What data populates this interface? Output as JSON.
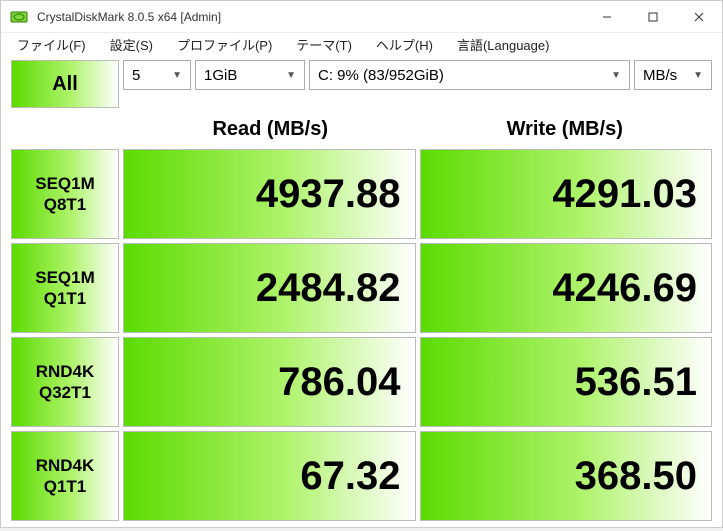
{
  "window": {
    "title": "CrystalDiskMark 8.0.5 x64 [Admin]"
  },
  "menu": {
    "file": "ファイル(F)",
    "settings": "設定(S)",
    "profile": "プロファイル(P)",
    "theme": "テーマ(T)",
    "help": "ヘルプ(H)",
    "language": "言語(Language)"
  },
  "toolbar": {
    "all_label": "All",
    "runs": "5",
    "size": "1GiB",
    "drive": "C: 9% (83/952GiB)",
    "unit": "MB/s"
  },
  "headers": {
    "read": "Read (MB/s)",
    "write": "Write (MB/s)"
  },
  "tests": [
    {
      "line1": "SEQ1M",
      "line2": "Q8T1",
      "read": "4937.88",
      "write": "4291.03"
    },
    {
      "line1": "SEQ1M",
      "line2": "Q1T1",
      "read": "2484.82",
      "write": "4246.69"
    },
    {
      "line1": "RND4K",
      "line2": "Q32T1",
      "read": "786.04",
      "write": "536.51"
    },
    {
      "line1": "RND4K",
      "line2": "Q1T1",
      "read": "67.32",
      "write": "368.50"
    }
  ]
}
